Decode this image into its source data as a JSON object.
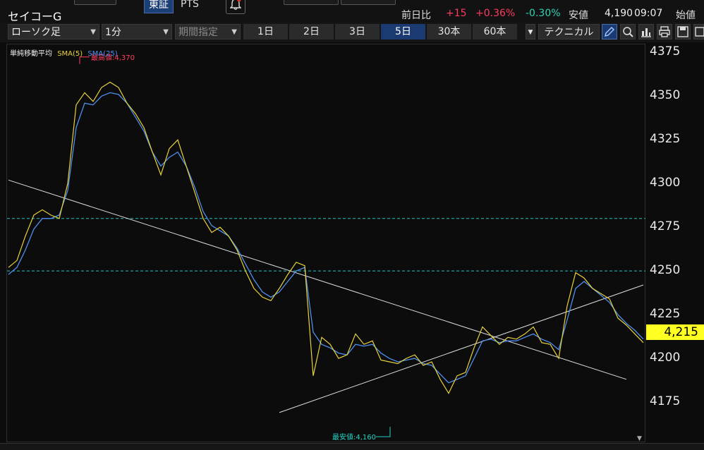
{
  "header": {
    "stock_name": "セイコーG",
    "exchange_tabs": [
      "東証",
      "PTS"
    ],
    "active_exchange": "東証",
    "quote": {
      "change_label": "前日比",
      "change_value": "+15",
      "change_pct": "+0.36%",
      "low_diff_pct": "-0.30%",
      "low_label": "安値",
      "low_value": "4,190",
      "low_time": "09:07",
      "open_label": "始値"
    }
  },
  "toolbar": {
    "chart_type": "ローソク足",
    "interval": "1分",
    "period_placeholder": "期間指定",
    "ranges": [
      "1日",
      "2日",
      "3日",
      "5日",
      "30本",
      "60本"
    ],
    "active_range": "5日",
    "technical_label": "テクニカル"
  },
  "chart_data": {
    "type": "line",
    "legend": {
      "group": "単純移動平均",
      "series": [
        {
          "name": "SMA(5)",
          "color": "#e8d33a"
        },
        {
          "name": "SMA(25)",
          "color": "#4e8ff0"
        }
      ]
    },
    "ylim": [
      4152,
      4380
    ],
    "yticks": [
      4175,
      4200,
      4225,
      4250,
      4275,
      4300,
      4325,
      4350,
      4375
    ],
    "ytick_labels": [
      "4175",
      "4200",
      "4225",
      "4250",
      "4275",
      "4300",
      "4325",
      "4350",
      "4375"
    ],
    "current_price": "4,215",
    "current_value": 4215,
    "hlines": [
      4280,
      4250
    ],
    "high_annotation": {
      "text": "最高値:4,370",
      "value": 4370
    },
    "low_annotation": {
      "text": "最安値:4,160",
      "value": 4160
    },
    "n_points": 60,
    "sma5": [
      4252,
      4256,
      4270,
      4282,
      4285,
      4282,
      4280,
      4300,
      4345,
      4352,
      4347,
      4355,
      4358,
      4355,
      4346,
      4340,
      4332,
      4318,
      4305,
      4320,
      4325,
      4310,
      4295,
      4280,
      4272,
      4275,
      4270,
      4262,
      4250,
      4240,
      4235,
      4233,
      4240,
      4248,
      4255,
      4253,
      4190,
      4212,
      4208,
      4200,
      4202,
      4214,
      4208,
      4210,
      4199,
      4198,
      4197,
      4200,
      4202,
      4196,
      4198,
      4188,
      4180,
      4190,
      4192,
      4206,
      4218,
      4213,
      4208,
      4212,
      4211,
      4214,
      4218,
      4209,
      4208,
      4200,
      4230,
      4249,
      4246,
      4240,
      4237,
      4234,
      4223,
      4219,
      4214,
      4209
    ],
    "sma25": [
      4248,
      4252,
      4262,
      4274,
      4280,
      4280,
      4282,
      4296,
      4332,
      4346,
      4345,
      4350,
      4352,
      4351,
      4346,
      4338,
      4330,
      4318,
      4310,
      4315,
      4318,
      4310,
      4298,
      4284,
      4276,
      4273,
      4270,
      4263,
      4254,
      4245,
      4238,
      4235,
      4238,
      4244,
      4250,
      4252,
      4215,
      4208,
      4206,
      4203,
      4202,
      4208,
      4207,
      4208,
      4203,
      4200,
      4198,
      4199,
      4200,
      4197,
      4196,
      4191,
      4186,
      4188,
      4190,
      4200,
      4210,
      4211,
      4209,
      4210,
      4210,
      4212,
      4214,
      4211,
      4209,
      4205,
      4222,
      4240,
      4244,
      4240,
      4236,
      4232,
      4225,
      4220,
      4216,
      4211
    ],
    "trendlines": [
      {
        "from": [
          0,
          4302
        ],
        "to": [
          73,
          4188
        ]
      },
      {
        "from": [
          32,
          4169
        ],
        "to": [
          75,
          4242
        ]
      }
    ]
  }
}
